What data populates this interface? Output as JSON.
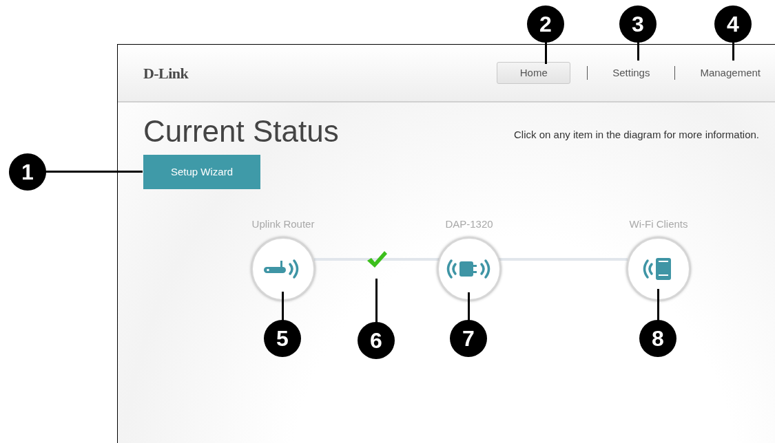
{
  "header": {
    "logo": "D-Link",
    "nav": [
      {
        "label": "Home",
        "selected": true
      },
      {
        "label": "Settings",
        "selected": false
      },
      {
        "label": "Management",
        "selected": false
      }
    ]
  },
  "page": {
    "title": "Current Status",
    "hint": "Click on any item in the diagram for more information.",
    "setup_button": "Setup Wizard"
  },
  "diagram": {
    "nodes": [
      {
        "kind": "router",
        "label": "Uplink Router"
      },
      {
        "kind": "extender",
        "label": "DAP-1320"
      },
      {
        "kind": "clients",
        "label": "Wi-Fi Clients"
      }
    ],
    "uplink_connected": true
  },
  "callouts": [
    "1",
    "2",
    "3",
    "4",
    "5",
    "6",
    "7",
    "8"
  ]
}
